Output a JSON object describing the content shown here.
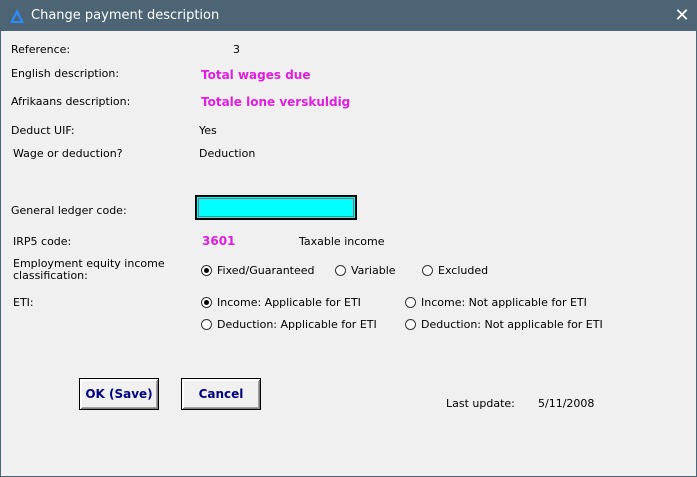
{
  "window": {
    "title": "Change payment description",
    "close_glyph": "✕"
  },
  "fields": {
    "reference_label": "Reference:",
    "reference_value": "3",
    "english_label": "English description:",
    "english_value": "Total wages due",
    "afrikaans_label": "Afrikaans description:",
    "afrikaans_value": "Totale lone verskuldig",
    "uif_label": "Deduct UIF:",
    "uif_value": "Yes",
    "wage_label": "Wage or deduction?",
    "wage_value": "Deduction",
    "ledger_label": "General ledger code:",
    "ledger_value": "",
    "irp5_label": "IRP5 code:",
    "irp5_code": "3601",
    "irp5_desc": "Taxable income",
    "equity_label_line1": "Employment equity income",
    "equity_label_line2": "classification:",
    "eti_label": "ETI:",
    "last_update_label": "Last update:",
    "last_update_value": "5/11/2008"
  },
  "equity_options": [
    {
      "label": "Fixed/Guaranteed",
      "selected": true
    },
    {
      "label": "Variable",
      "selected": false
    },
    {
      "label": "Excluded",
      "selected": false
    }
  ],
  "eti_options": [
    {
      "label": "Income: Applicable for ETI",
      "selected": true
    },
    {
      "label": "Income: Not applicable for ETI",
      "selected": false
    },
    {
      "label": "Deduction: Applicable for ETI",
      "selected": false
    },
    {
      "label": "Deduction: Not applicable for ETI",
      "selected": false
    }
  ],
  "buttons": {
    "ok_label": "OK (Save)",
    "cancel_label": "Cancel"
  },
  "colors": {
    "titlebar": "#4d6474",
    "highlight_text": "#e01ee0",
    "ledger_input_bg": "#00ffff",
    "button_text": "#000080"
  },
  "icons": {
    "app": "triangle-logo-icon",
    "close": "close-icon",
    "radio": "radio-button"
  }
}
